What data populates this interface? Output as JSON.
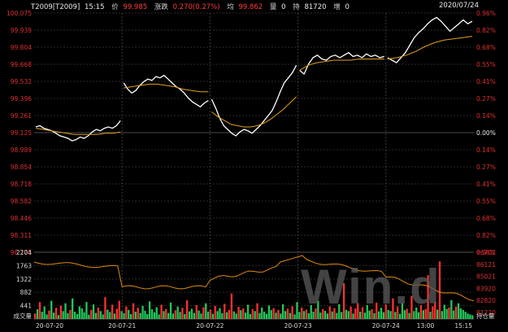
{
  "header": {
    "code": "T2009[T2009]",
    "time": "15:15",
    "price_label": "价",
    "price": "99.985",
    "change_label": "涨跌",
    "change": "0.270(0.27%)",
    "avg_label": "均",
    "avg": "99.862",
    "vol_label": "量",
    "vol": "0",
    "oi_label": "持",
    "oi": "81720",
    "oi_chg_label": "增",
    "oi_chg": "0",
    "date": "2020/07/24"
  },
  "watermark": "Win.d",
  "colors": {
    "price_line": "#ffffff",
    "avg_line": "#e0a020",
    "oi_line": "#e08a10",
    "up": "#ff3030",
    "down": "#22c75a",
    "left_axis": "#e03030",
    "right_axis": "#e03030",
    "grid": "#2a2a2a"
  },
  "chart_data": [
    {
      "type": "line",
      "price_axis": [
        "100.075",
        "99.939",
        "99.804",
        "99.668",
        "99.532",
        "99.396",
        "99.261",
        "99.125",
        "98.989",
        "98.854",
        "98.718",
        "98.582",
        "98.446",
        "98.311",
        "98.175"
      ],
      "pct_axis": [
        "0.96%",
        "0.82%",
        "0.68%",
        "0.55%",
        "0.41%",
        "0.27%",
        "0.14%",
        "0.00%",
        "0.14%",
        "0.27%",
        "0.41%",
        "0.55%",
        "0.68%",
        "0.82%",
        "0.96%"
      ],
      "ylim": [
        98.175,
        100.075
      ],
      "base": 99.125,
      "x_labels": [
        "20-07-20",
        "20-07-21",
        "20-07-22",
        "20-07-23",
        "20-07-24",
        "13:00",
        "15:15"
      ],
      "days": [
        {
          "price": [
            99.17,
            99.18,
            99.16,
            99.15,
            99.14,
            99.12,
            99.1,
            99.09,
            99.08,
            99.06,
            99.07,
            99.09,
            99.08,
            99.1,
            99.13,
            99.15,
            99.14,
            99.16,
            99.17,
            99.16,
            99.18,
            99.22
          ],
          "avg": [
            99.16,
            99.15,
            99.14,
            99.13,
            99.12,
            99.11,
            99.11,
            99.11,
            99.11,
            99.12,
            99.12,
            99.13
          ]
        },
        {
          "price": [
            99.52,
            99.47,
            99.44,
            99.46,
            99.5,
            99.53,
            99.55,
            99.54,
            99.57,
            99.56,
            99.58,
            99.55,
            99.52,
            99.49,
            99.47,
            99.44,
            99.4,
            99.37,
            99.35,
            99.33,
            99.36,
            99.38
          ],
          "avg": [
            99.48,
            99.49,
            99.5,
            99.51,
            99.51,
            99.5,
            99.49,
            99.47,
            99.46,
            99.45,
            99.45
          ]
        },
        {
          "price": [
            99.39,
            99.32,
            99.24,
            99.18,
            99.15,
            99.12,
            99.1,
            99.13,
            99.15,
            99.14,
            99.12,
            99.15,
            99.18,
            99.22,
            99.26,
            99.3,
            99.37,
            99.45,
            99.52,
            99.56,
            99.6,
            99.66
          ],
          "avg": [
            99.29,
            99.25,
            99.22,
            99.19,
            99.18,
            99.17,
            99.17,
            99.18,
            99.2,
            99.23,
            99.27,
            99.31,
            99.36,
            99.41
          ]
        },
        {
          "price": [
            99.62,
            99.59,
            99.67,
            99.72,
            99.74,
            99.71,
            99.7,
            99.73,
            99.74,
            99.72,
            99.74,
            99.76,
            99.73,
            99.74,
            99.72,
            99.75,
            99.73,
            99.74,
            99.72,
            99.73
          ],
          "avg": [
            99.62,
            99.66,
            99.68,
            99.69,
            99.7,
            99.7,
            99.7,
            99.71,
            99.71,
            99.71,
            99.71
          ]
        },
        {
          "price": [
            99.72,
            99.7,
            99.68,
            99.72,
            99.76,
            99.82,
            99.88,
            99.92,
            99.95,
            99.99,
            100.02,
            100.04,
            100.01,
            99.97,
            99.93,
            99.96,
            99.99,
            100.02,
            99.99,
            100.01
          ],
          "avg": [
            99.71,
            99.72,
            99.74,
            99.77,
            99.81,
            99.84,
            99.86,
            99.87,
            99.88,
            99.89
          ]
        }
      ]
    },
    {
      "type": "bar",
      "left_axis": [
        "2204",
        "1763",
        "1322",
        "882",
        "441"
      ],
      "right_axis": [
        "86702",
        "86121",
        "85021",
        "83920",
        "82820",
        "81720"
      ],
      "volume_label": "成交量",
      "oi_label": "持仓量",
      "volume": [
        180,
        320,
        560,
        240,
        410,
        150,
        280,
        600,
        210,
        370,
        130,
        440,
        260,
        520,
        190,
        300,
        680,
        240,
        160,
        420,
        350,
        220,
        560,
        140,
        300,
        480,
        200,
        380,
        260,
        150,
        720,
        310,
        230,
        470,
        180,
        340,
        600,
        260,
        190,
        410,
        300,
        160,
        520,
        240,
        370,
        200,
        430,
        270,
        160,
        580,
        320,
        220,
        390,
        150,
        470,
        260,
        330,
        200,
        540,
        180,
        290,
        410,
        230,
        370,
        160,
        620,
        250,
        340,
        200,
        460,
        280,
        180,
        390,
        520,
        240,
        310,
        170,
        430,
        260,
        360,
        190,
        500,
        220,
        300,
        840,
        250,
        180,
        400,
        290,
        350,
        210,
        470,
        160,
        330,
        260,
        520,
        200,
        380,
        240,
        170,
        450,
        290,
        360,
        210,
        300,
        180,
        490,
        260,
        340,
        200,
        420,
        150,
        560,
        230,
        380,
        260,
        310,
        190,
        460,
        240,
        350,
        600,
        210,
        330,
        270,
        180,
        420,
        250,
        360,
        200,
        490,
        230,
        1180,
        300,
        260,
        410,
        180,
        350,
        520,
        240,
        390,
        210,
        460,
        280,
        320,
        190,
        540,
        250,
        370,
        220,
        480,
        300,
        260,
        680,
        230,
        410,
        170,
        520,
        290,
        340,
        200,
        760,
        260,
        380,
        220,
        460,
        290,
        330,
        1450,
        240,
        420,
        560,
        310,
        1900,
        260,
        470,
        330,
        380,
        620,
        280,
        410,
        520,
        350,
        300,
        240,
        180,
        150,
        120
      ]
    }
  ]
}
